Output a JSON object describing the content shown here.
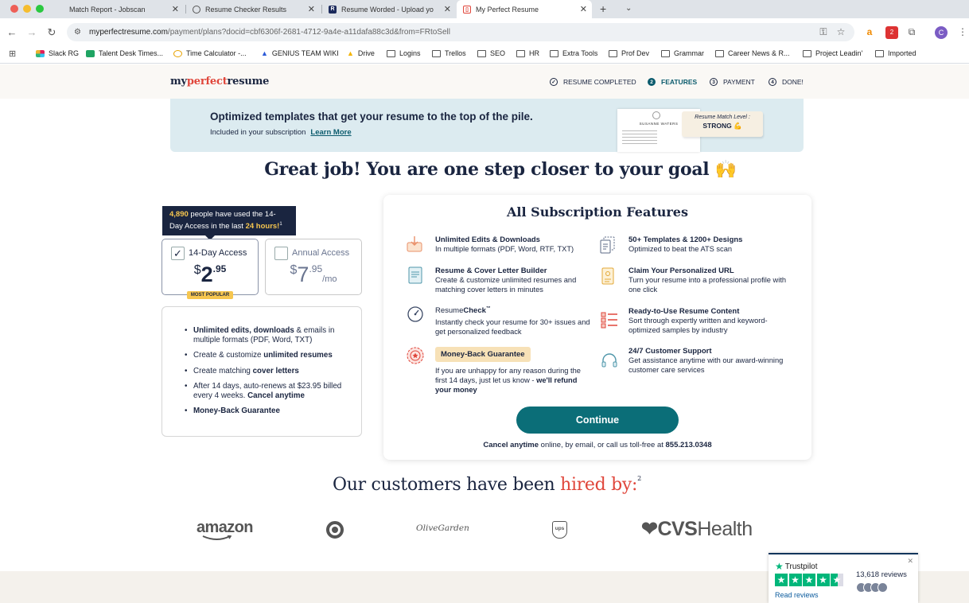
{
  "browser": {
    "tabs": [
      {
        "title": "Match Report - Jobscan",
        "active": false
      },
      {
        "title": "Resume Checker Results",
        "active": false
      },
      {
        "title": "Resume Worded - Upload yo",
        "active": false
      },
      {
        "title": "My Perfect Resume",
        "active": true
      }
    ],
    "url_main": "myperfectresume.com",
    "url_rest": "/payment/plans?docid=cbf6306f-2681-4712-9a4e-a11dafa88c3d&from=FRtoSell",
    "profile_initial": "C",
    "ext_badge": "2",
    "bookmarks": [
      "Slack RG",
      "Talent Desk Times...",
      "Time Calculator -...",
      "GENIUS TEAM WIKI",
      "Drive",
      "Logins",
      "Trellos",
      "SEO",
      "HR",
      "Extra Tools",
      "Prof Dev",
      "Grammar",
      "Career News & R...",
      "Project Leadin'",
      "Imported"
    ]
  },
  "header": {
    "logo_a": "my",
    "logo_b": "perfect",
    "logo_c": "resume",
    "steps": [
      {
        "num": "✓",
        "label": "RESUME COMPLETED"
      },
      {
        "num": "2",
        "label": "FEATURES"
      },
      {
        "num": "3",
        "label": "PAYMENT"
      },
      {
        "num": "4",
        "label": "DONE!"
      }
    ]
  },
  "banner": {
    "title": "Optimized templates that get your resume to the top of the pile.",
    "subtitle": "Included in your subscription",
    "learn_more": "Learn More",
    "thumb_name": "SUSANNE WATERS",
    "match_label": "Resume Match Level :",
    "match_value": "STRONG 💪"
  },
  "headline": "Great job! You are one step closer to your goal 🙌",
  "plans": {
    "tooltip_count": "4,890",
    "tooltip_mid": " people have used the 14-Day Access in the last ",
    "tooltip_hours": "24 hours!",
    "tooltip_sup": "1",
    "trial": {
      "name": "14-Day Access",
      "currency": "$",
      "dollars": "2",
      "cents": ".95",
      "checked": "✓"
    },
    "annual": {
      "name": "Annual Access",
      "currency": "$",
      "dollars": "7",
      "cents": ".95",
      "per": "/mo"
    },
    "badge": "MOST POPULAR",
    "features": [
      {
        "bold1": "Unlimited edits, downloads",
        "text1": " & emails in multiple formats (PDF, Word, TXT)",
        "bold2": "",
        "text2": ""
      },
      {
        "bold1": "",
        "text1": "Create & customize ",
        "bold2": "unlimited resumes",
        "text2": ""
      },
      {
        "bold1": "",
        "text1": "Create matching ",
        "bold2": "cover letters",
        "text2": ""
      },
      {
        "bold1": "",
        "text1": "After 14 days, auto-renews at $23.95 billed every 4 weeks. ",
        "bold2": "Cancel anytime",
        "text2": ""
      },
      {
        "bold1": "Money-Back Guarantee",
        "text1": "",
        "bold2": "",
        "text2": ""
      }
    ]
  },
  "card": {
    "title": "All Subscription Features",
    "features": [
      {
        "title": "Unlimited Edits & Downloads",
        "desc": "In multiple formats (PDF, Word, RTF, TXT)"
      },
      {
        "title": "50+ Templates & 1200+ Designs",
        "desc": "Optimized to beat the ATS scan"
      },
      {
        "title": "Resume & Cover Letter Builder",
        "desc": "Create & customize unlimited resumes and matching cover letters in minutes"
      },
      {
        "title": "Claim Your Personalized URL",
        "desc": "Turn your resume into a professional profile with one click"
      },
      {
        "title_a": "Resume",
        "title_b": "Check",
        "title_tm": "™",
        "desc": "Instantly check your resume for 30+ issues and get personalized feedback"
      },
      {
        "title": "Ready-to-Use Resume Content",
        "desc": "Sort through expertly written and keyword-optimized samples by industry"
      },
      {
        "title": "Money-Back Guarantee",
        "desc": "If you are unhappy for any reason during the first 14 days, just let us know - ",
        "desc_bold": "we'll refund your money"
      },
      {
        "title": "24/7 Customer Support",
        "desc": "Get assistance anytime with our award-winning customer care services"
      }
    ],
    "continue": "Continue",
    "cancel_bold": "Cancel anytime",
    "cancel_text": " online, by email, or call us toll-free at ",
    "phone": "855.213.0348"
  },
  "hired": {
    "text": "Our customers have been ",
    "red": "hired by:",
    "sup": "2",
    "logos": {
      "amazon": "amazon",
      "olive": "OliveGarden",
      "ups": "ups",
      "cvs_a": "❤CVS",
      "cvs_b": "Health"
    }
  },
  "trustpilot": {
    "brand": "Trustpilot",
    "reviews": "13,618 reviews",
    "read": "Read reviews",
    "rating": 4.5
  },
  "colors": {
    "navy": "#1a2540",
    "red": "#e0463b",
    "teal": "#0b6e78",
    "gold": "#f6c64f",
    "trustpilot": "#00b67a"
  }
}
